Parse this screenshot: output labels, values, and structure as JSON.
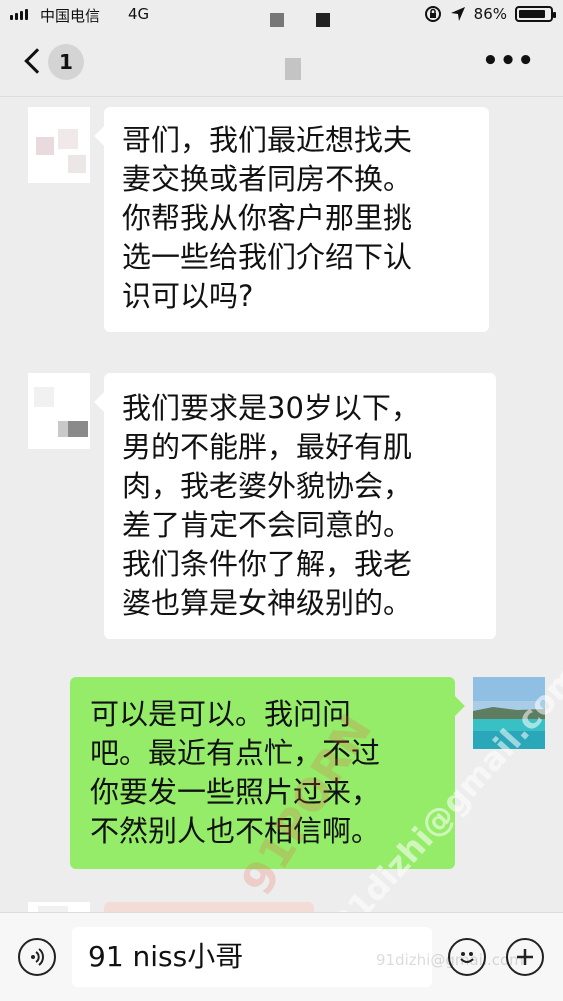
{
  "status_bar": {
    "carrier": "中国电信",
    "network": "4G",
    "battery_percent": "86%",
    "battery_level": 0.86
  },
  "nav": {
    "unread_count": "1",
    "more_label": "•••"
  },
  "messages": [
    {
      "side": "incoming",
      "text": "哥们，我们最近想找夫\n妻交换或者同房不换。\n你帮我从你客户那里挑\n选一些给我们介绍下认\n识可以吗?"
    },
    {
      "side": "incoming",
      "text": "我们要求是30岁以下，\n男的不能胖，最好有肌\n肉，我老婆外貌协会，\n差了肯定不会同意的。\n我们条件你了解，我老\n婆也算是女神级别的。"
    },
    {
      "side": "outgoing",
      "text": "可以是可以。我问问\n吧。最近有点忙，不过\n你要发一些照片过来，\n不然别人也不相信啊。"
    }
  ],
  "watermarks": {
    "site": "91dizhi@gmail.com",
    "logo": "91PORN",
    "bottom": "91dizhi@gmail.com"
  },
  "input": {
    "value": "91 niss小哥"
  },
  "icons": {
    "voice": "voice-icon",
    "emoji": "emoji-icon",
    "add": "plus-icon",
    "back": "chevron-left-icon",
    "more": "more-dots-icon"
  },
  "colors": {
    "background": "#ededed",
    "outgoing_bubble": "#95ec69",
    "incoming_bubble": "#ffffff"
  }
}
